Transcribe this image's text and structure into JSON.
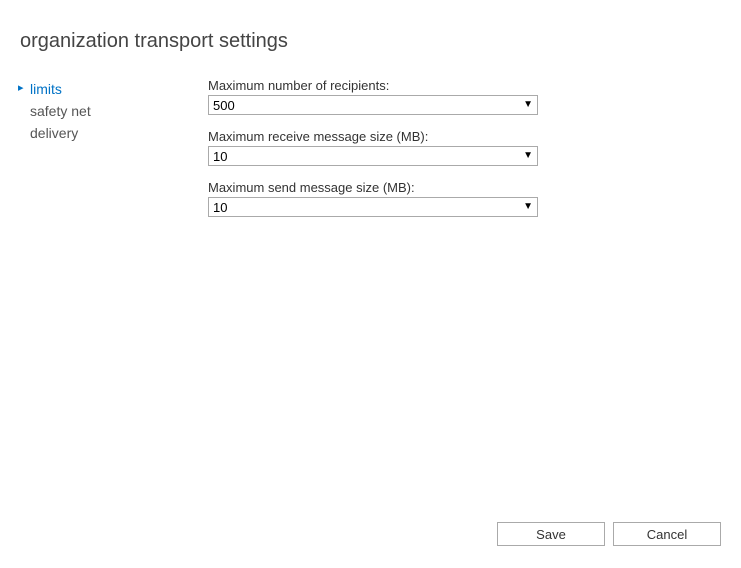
{
  "title": "organization transport settings",
  "sidebar": {
    "items": [
      {
        "label": "limits",
        "active": true
      },
      {
        "label": "safety net",
        "active": false
      },
      {
        "label": "delivery",
        "active": false
      }
    ]
  },
  "form": {
    "max_recipients": {
      "label": "Maximum number of recipients:",
      "value": "500"
    },
    "max_receive_size": {
      "label": "Maximum receive message size (MB):",
      "value": "10"
    },
    "max_send_size": {
      "label": "Maximum send message size (MB):",
      "value": "10"
    }
  },
  "footer": {
    "save_label": "Save",
    "cancel_label": "Cancel"
  }
}
